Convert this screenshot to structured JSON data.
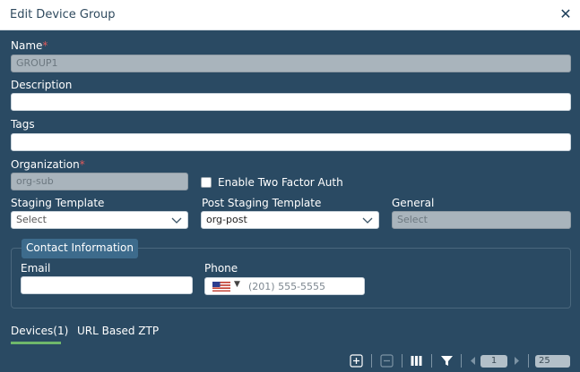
{
  "dialog": {
    "title": "Edit Device Group",
    "close_label": "✕"
  },
  "form": {
    "name": {
      "label": "Name",
      "required_mark": "*",
      "value": "GROUP1"
    },
    "description": {
      "label": "Description",
      "value": ""
    },
    "tags": {
      "label": "Tags",
      "value": ""
    },
    "organization": {
      "label": "Organization",
      "required_mark": "*",
      "value": "org-sub"
    },
    "two_factor": {
      "label": "Enable Two Factor Auth",
      "checked": false
    },
    "staging_template": {
      "label": "Staging Template",
      "value": "Select"
    },
    "post_staging_template": {
      "label": "Post Staging Template",
      "value": "org-post"
    },
    "general": {
      "label": "General",
      "value": "Select"
    }
  },
  "contact": {
    "legend": "Contact Information",
    "email": {
      "label": "Email",
      "value": ""
    },
    "phone": {
      "label": "Phone",
      "placeholder": "(201) 555-5555",
      "country": "US"
    }
  },
  "tabs": [
    {
      "label": "Devices(1)",
      "active": true
    },
    {
      "label": "URL Based ZTP",
      "active": false
    }
  ],
  "toolbar": {
    "page": "1",
    "page_size": "25",
    "icons": [
      "add-icon",
      "remove-icon",
      "columns-icon",
      "filter-icon",
      "prev-page-icon",
      "next-page-icon"
    ]
  },
  "colors": {
    "background": "#2a4a63",
    "accent_tab": "#6fb86b",
    "legend_bg": "#3d6b8c",
    "required": "#e05a5a"
  }
}
